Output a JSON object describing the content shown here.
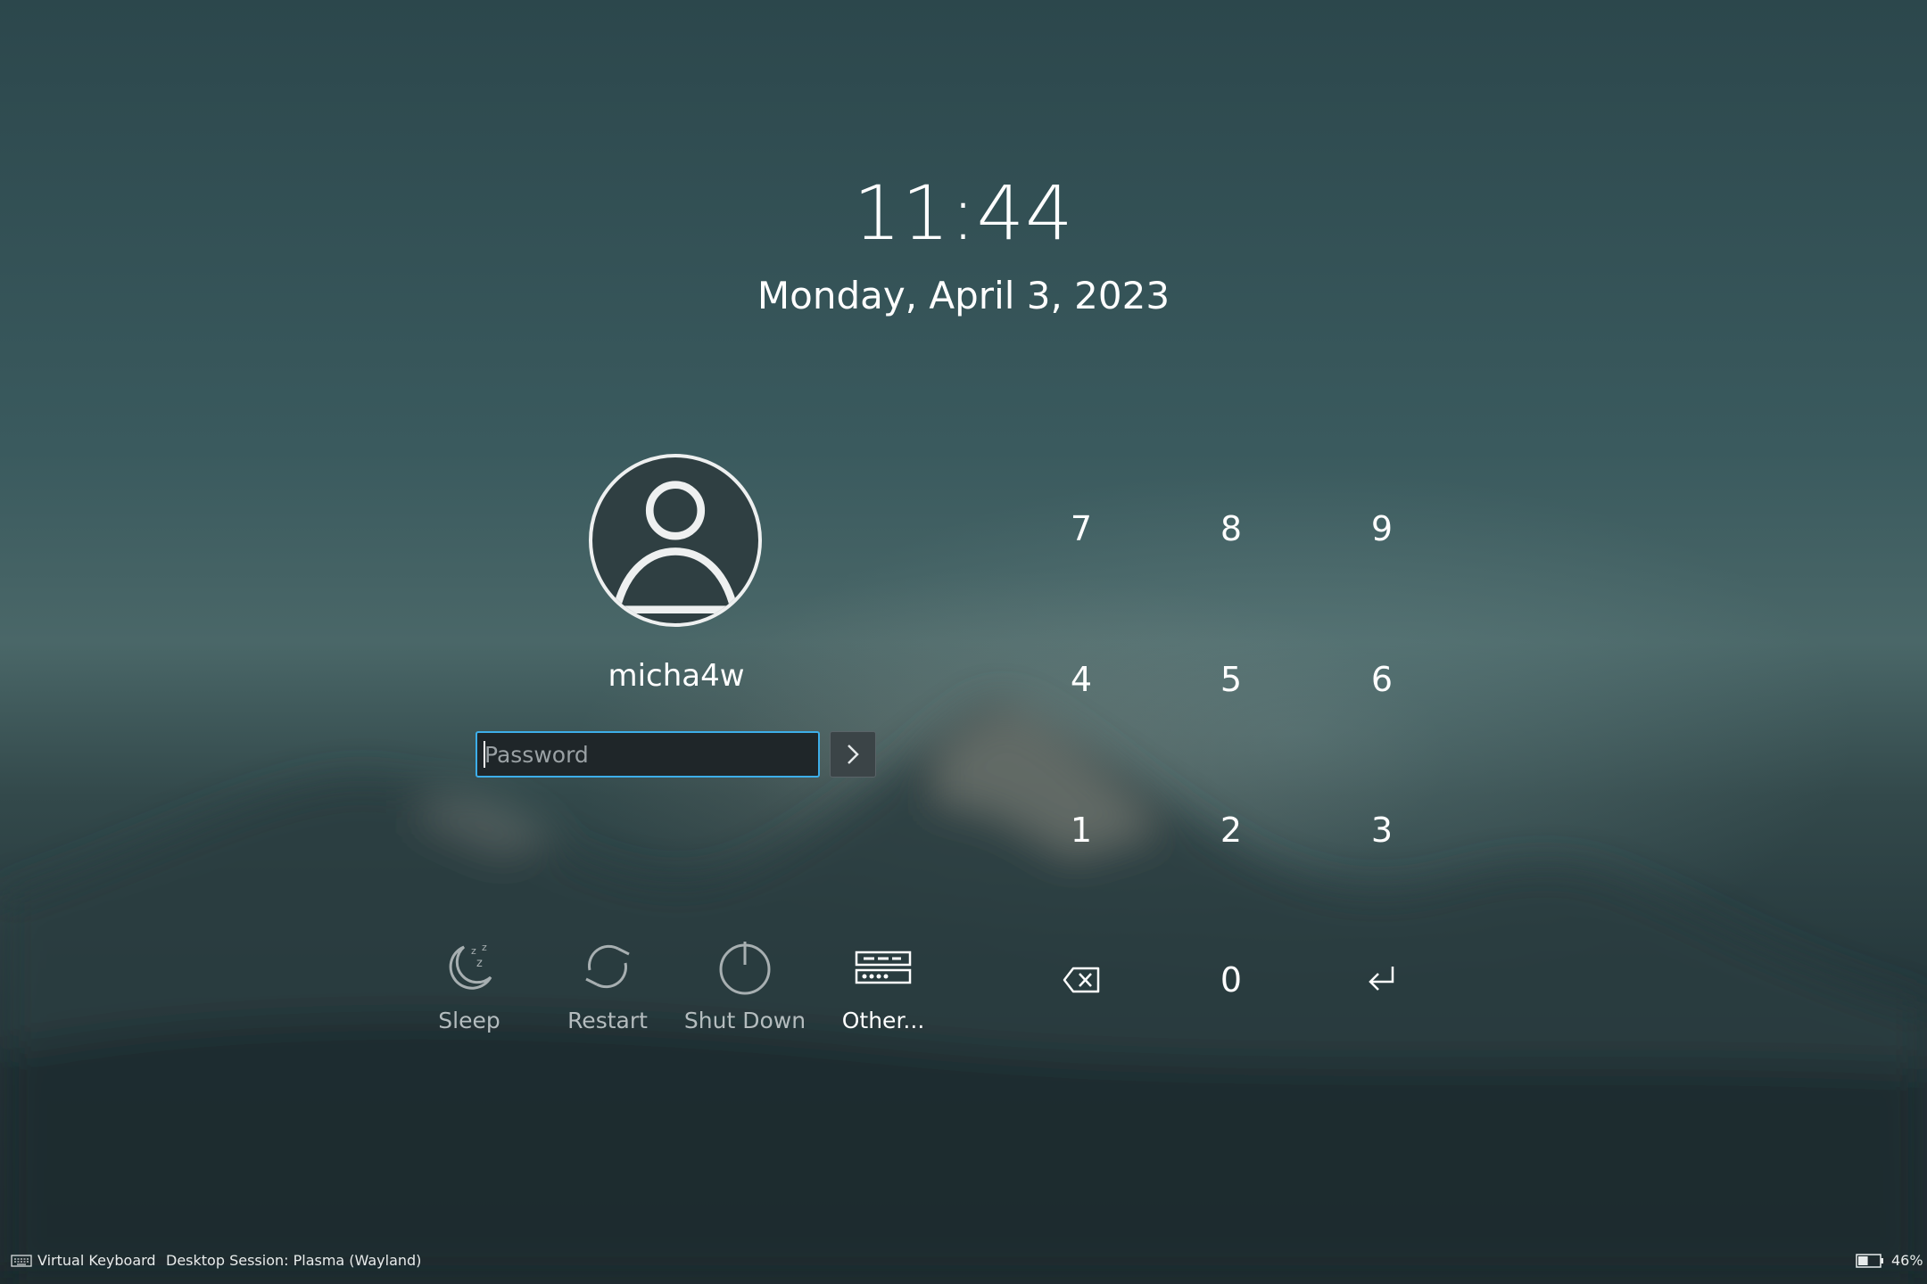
{
  "clock": {
    "time": "11:44",
    "date": "Monday, April 3, 2023"
  },
  "user": {
    "name": "micha4w",
    "avatar_icon": "user-avatar-icon"
  },
  "password": {
    "placeholder": "Password",
    "value": ""
  },
  "login_button": {
    "icon": "chevron-right-icon"
  },
  "actions": [
    {
      "label": "Sleep",
      "icon": "sleep-icon"
    },
    {
      "label": "Restart",
      "icon": "restart-icon"
    },
    {
      "label": "Shut Down",
      "icon": "power-icon"
    },
    {
      "label": "Other...",
      "icon": "switch-user-icon"
    }
  ],
  "keypad": {
    "rows": [
      [
        "7",
        "8",
        "9"
      ],
      [
        "4",
        "5",
        "6"
      ],
      [
        "1",
        "2",
        "3"
      ]
    ],
    "zero": "0",
    "backspace_icon": "backspace-icon",
    "enter_icon": "enter-icon"
  },
  "status_bar": {
    "virtual_keyboard": "Virtual Keyboard",
    "session": "Desktop Session: Plasma (Wayland)",
    "battery": "46%",
    "battery_level": 0.46
  },
  "colors": {
    "accent": "#3daee9",
    "field_bg": "#1f2629"
  }
}
